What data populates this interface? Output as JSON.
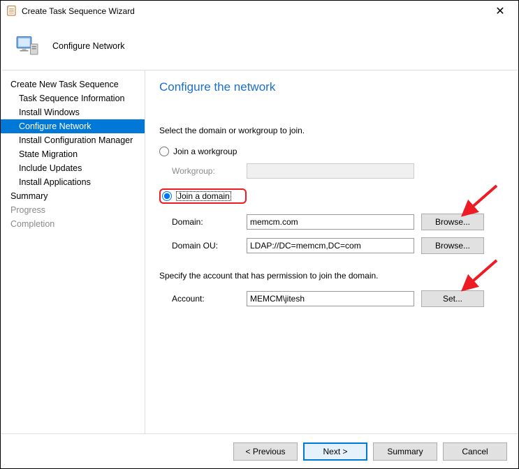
{
  "window": {
    "title": "Create Task Sequence Wizard",
    "headerTitle": "Configure Network"
  },
  "nav": {
    "root": "Create New Task Sequence",
    "items": [
      "Task Sequence Information",
      "Install Windows",
      "Configure Network",
      "Install Configuration Manager",
      "State Migration",
      "Include Updates",
      "Install Applications"
    ],
    "summary": "Summary",
    "progress": "Progress",
    "completion": "Completion",
    "selected": "Configure Network"
  },
  "content": {
    "title": "Configure the network",
    "intro": "Select the domain or workgroup to join.",
    "radioWorkgroup": "Join a workgroup",
    "workgroupLabel": "Workgroup:",
    "workgroupValue": "",
    "radioDomain": "Join a domain",
    "domainLabel": "Domain:",
    "domainValue": "memcm.com",
    "domainOuLabel": "Domain OU:",
    "domainOuValue": "LDAP://DC=memcm,DC=com",
    "browseLabel": "Browse...",
    "specText": "Specify the account that has permission to join the domain.",
    "accountLabel": "Account:",
    "accountValue": "MEMCM\\jitesh",
    "setLabel": "Set..."
  },
  "footer": {
    "previous": "< Previous",
    "next": "Next >",
    "summary": "Summary",
    "cancel": "Cancel"
  }
}
